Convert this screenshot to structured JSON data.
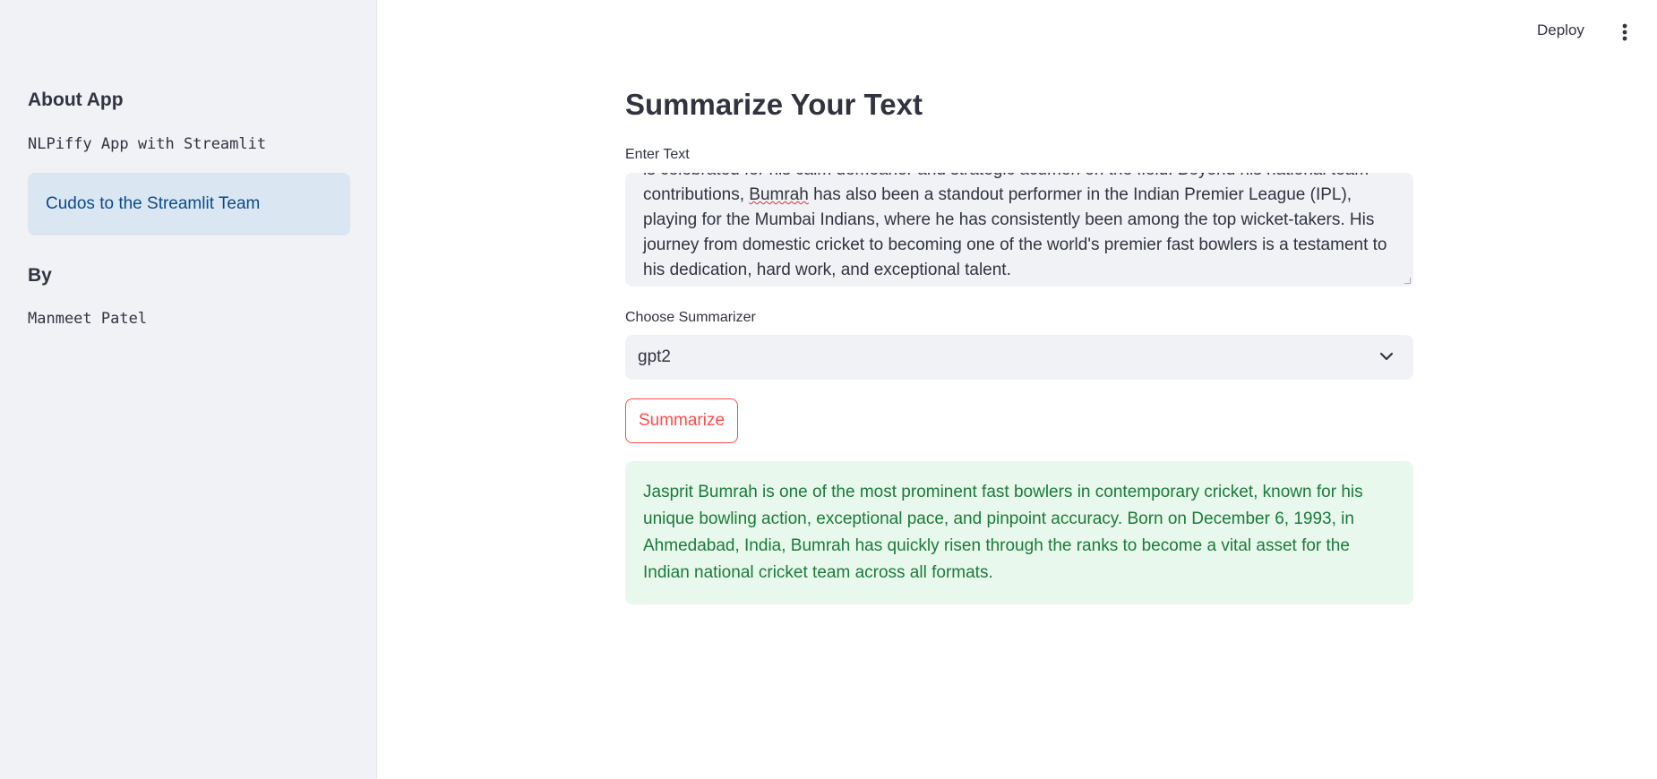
{
  "topbar": {
    "deploy_label": "Deploy",
    "menu_icon": "vertical-ellipsis-icon"
  },
  "sidebar": {
    "about_heading": "About App",
    "about_text": "NLPiffy App with Streamlit",
    "info_text": "Cudos to the Streamlit Team",
    "by_heading": "By",
    "author": "Manmeet Patel"
  },
  "main": {
    "title": "Summarize Your Text",
    "text_label": "Enter Text",
    "text_lines": [
      "is celebrated for his calm demeanor and strategic acumen on the field. Beyond his national team",
      "contributions, ",
      "Bumrah",
      " has also been a standout performer in the Indian Premier League (IPL),",
      "playing for the Mumbai Indians, where he has consistently been among the top wicket-takers. His",
      "journey from domestic cricket to becoming one of the world's premier fast bowlers is a testament to",
      "his dedication, hard work, and exceptional talent."
    ],
    "summarizer_label": "Choose Summarizer",
    "summarizer_value": "gpt2",
    "button_label": "Summarize",
    "result_text": "Jasprit Bumrah is one of the most prominent fast bowlers in contemporary cricket, known for his unique bowling action, exceptional pace, and pinpoint accuracy. Born on December 6, 1993, in Ahmedabad, India, Bumrah has quickly risen through the ranks to become a vital asset for the Indian national cricket team across all formats."
  },
  "colors": {
    "sidebar_bg": "#f0f2f6",
    "info_bg": "#dbe6f3",
    "info_text": "#0b4b8a",
    "primary": "#ff4b4b",
    "success_bg": "#e8f8ec",
    "success_text": "#1a7a3a"
  }
}
